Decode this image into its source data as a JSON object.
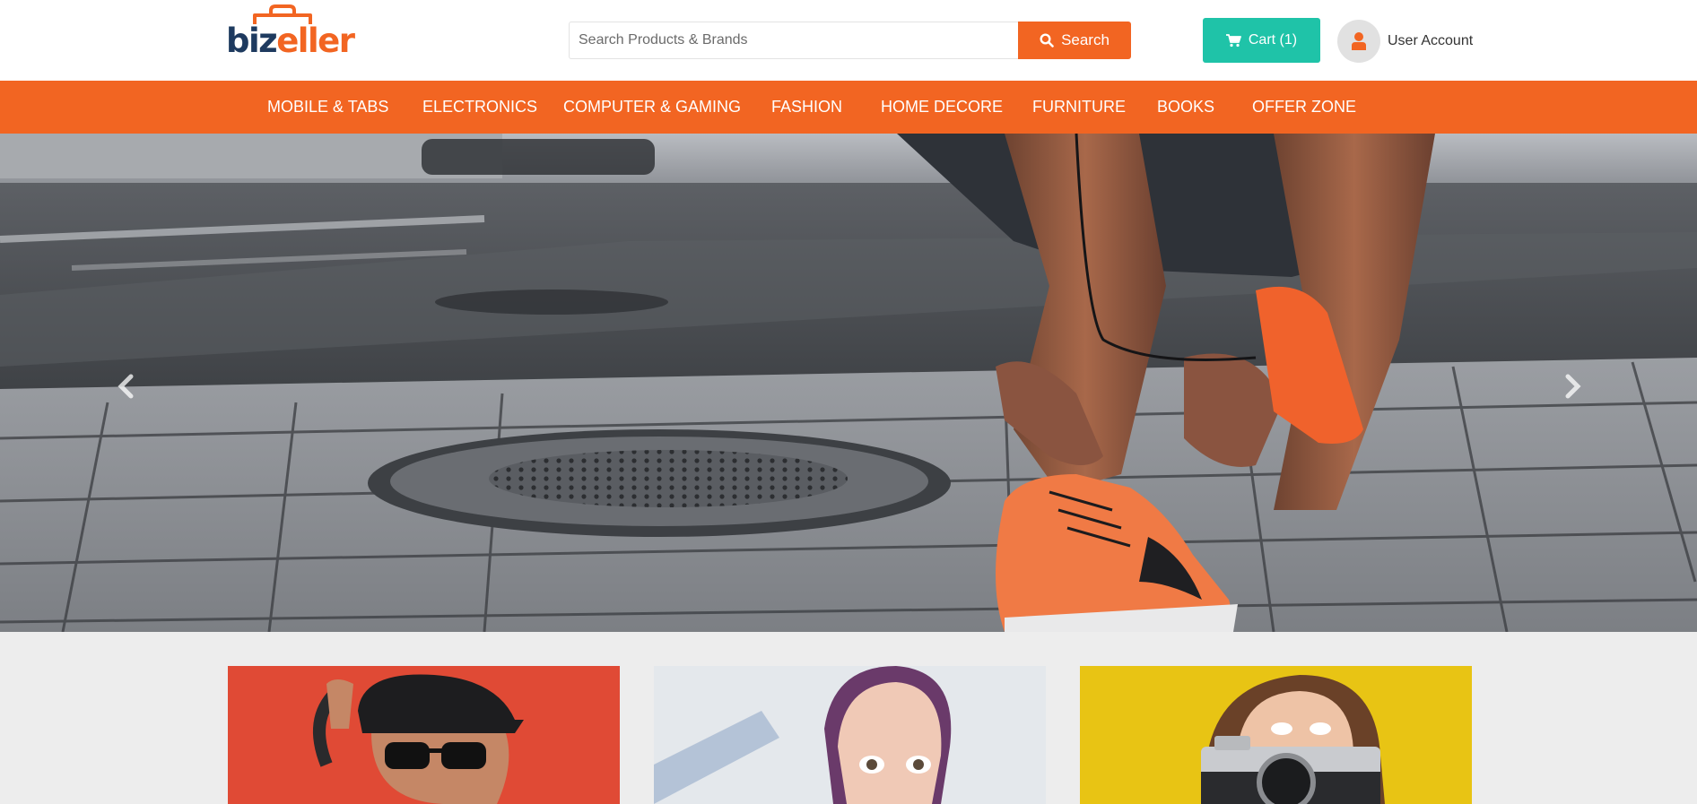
{
  "brand": {
    "logo_prefix": "biz",
    "logo_suffix": "eller",
    "primary_color": "#f26522",
    "secondary_color": "#1e3a5f",
    "accent_color": "#1fc3a8"
  },
  "header": {
    "search": {
      "placeholder": "Search Products & Brands",
      "value": "",
      "button_label": "Search",
      "icon": "search-icon"
    },
    "cart": {
      "label": "Cart (1)",
      "icon": "cart-icon"
    },
    "account": {
      "label": "User Account",
      "icon": "user-icon"
    }
  },
  "nav": {
    "items": [
      {
        "label": "MOBILE & TABS"
      },
      {
        "label": "ELECTRONICS"
      },
      {
        "label": "COMPUTER & GAMING"
      },
      {
        "label": "FASHION"
      },
      {
        "label": "HOME DECORE"
      },
      {
        "label": "FURNITURE"
      },
      {
        "label": "BOOKS"
      },
      {
        "label": "OFFER ZONE"
      }
    ]
  },
  "hero": {
    "prev_icon": "chevron-left-icon",
    "next_icon": "chevron-right-icon"
  },
  "cards": [
    {
      "background": "#e04a35"
    },
    {
      "background": "#e9ecef"
    },
    {
      "background": "#e8c414"
    }
  ]
}
